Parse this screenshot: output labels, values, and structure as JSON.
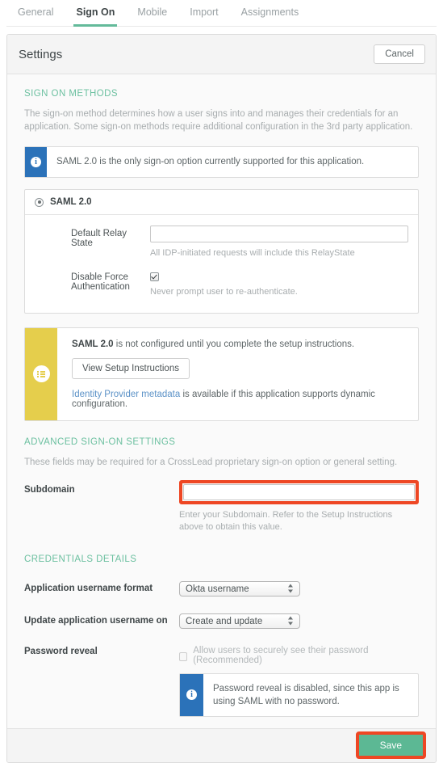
{
  "tabs": [
    {
      "label": "General",
      "active": false
    },
    {
      "label": "Sign On",
      "active": true
    },
    {
      "label": "Mobile",
      "active": false
    },
    {
      "label": "Import",
      "active": false
    },
    {
      "label": "Assignments",
      "active": false
    }
  ],
  "card": {
    "title": "Settings",
    "cancel_label": "Cancel",
    "save_label": "Save"
  },
  "sign_on_methods": {
    "heading": "SIGN ON METHODS",
    "description": "The sign-on method determines how a user signs into and manages their credentials for an application. Some sign-on methods require additional configuration in the 3rd party application.",
    "info_banner": {
      "icon": "info-icon",
      "text": "SAML 2.0 is the only sign-on option currently supported for this application."
    },
    "panel": {
      "radio_label": "SAML 2.0",
      "radio_selected": true,
      "fields": [
        {
          "label": "Default Relay State",
          "type": "text",
          "value": "",
          "hint": "All IDP-initiated requests will include this RelayState"
        },
        {
          "label": "Disable Force Authentication",
          "type": "checkbox",
          "checked": true,
          "hint": "Never prompt user to re-authenticate."
        }
      ]
    },
    "setup_box": {
      "icon": "list-icon",
      "message_bold": "SAML 2.0",
      "message_rest": " is not configured until you complete the setup instructions.",
      "button_label": "View Setup Instructions",
      "link_text": "Identity Provider metadata",
      "link_rest": " is available if this application supports dynamic configuration."
    }
  },
  "advanced": {
    "heading": "ADVANCED SIGN-ON SETTINGS",
    "description": "These fields may be required for a CrossLead proprietary sign-on option or general setting.",
    "subdomain": {
      "label": "Subdomain",
      "value": "",
      "placeholder": "",
      "hint": "Enter your Subdomain. Refer to the Setup Instructions above to obtain this value.",
      "highlighted": true
    }
  },
  "credentials": {
    "heading": "CREDENTIALS DETAILS",
    "username_format": {
      "label": "Application username format",
      "value": "Okta username"
    },
    "update_username_on": {
      "label": "Update application username on",
      "value": "Create and update"
    },
    "password_reveal": {
      "label": "Password reveal",
      "checkbox_label": "Allow users to securely see their password (Recommended)",
      "checked": false,
      "info_text": "Password reveal is disabled, since this app is using SAML with no password."
    }
  },
  "colors": {
    "accent_green": "#63ba9a",
    "save_green": "#5cb894",
    "info_blue": "#2b72b9",
    "setup_yellow": "#e5ce4c",
    "highlight_red": "#ee4724",
    "section_heading": "#6cc0a0",
    "link_blue": "#5c92c7"
  }
}
